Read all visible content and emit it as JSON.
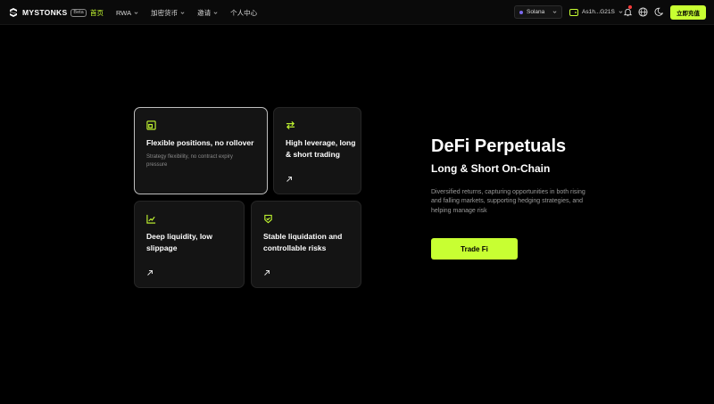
{
  "brand": {
    "name": "MYSTONKS",
    "badge": "Beta"
  },
  "nav": {
    "items": [
      {
        "label": "首页",
        "active": true,
        "dropdown": false
      },
      {
        "label": "RWA",
        "active": false,
        "dropdown": true
      },
      {
        "label": "加密货币",
        "active": false,
        "dropdown": true
      },
      {
        "label": "邀请",
        "active": false,
        "dropdown": true
      },
      {
        "label": "个人中心",
        "active": false,
        "dropdown": false
      }
    ],
    "chain_select": "Solana",
    "wallet_address": "As1h...G21S",
    "cta_label": "立即充值"
  },
  "cards": [
    {
      "title": "Flexible positions, no rollover",
      "description": "Strategy flexibility, no contract expiry pressure",
      "icon": "position-icon"
    },
    {
      "title": "High leverage, long & short trading",
      "icon": "swap-arrows-icon"
    },
    {
      "title": "Deep liquidity, low slippage",
      "icon": "trend-chart-icon"
    },
    {
      "title": "Stable liquidation and controllable risks",
      "icon": "shield-check-icon"
    }
  ],
  "hero": {
    "title": "DeFi Perpetuals",
    "subtitle": "Long & Short On-Chain",
    "description": "Diversified returns, capturing opportunities in both rising and falling markets, supporting hedging strategies, and helping manage risk",
    "button_label": "Trade Fi"
  },
  "colors": {
    "accent": "#c8ff32",
    "background": "#000000",
    "card": "#141414",
    "muted_text": "#9a9a9a"
  }
}
